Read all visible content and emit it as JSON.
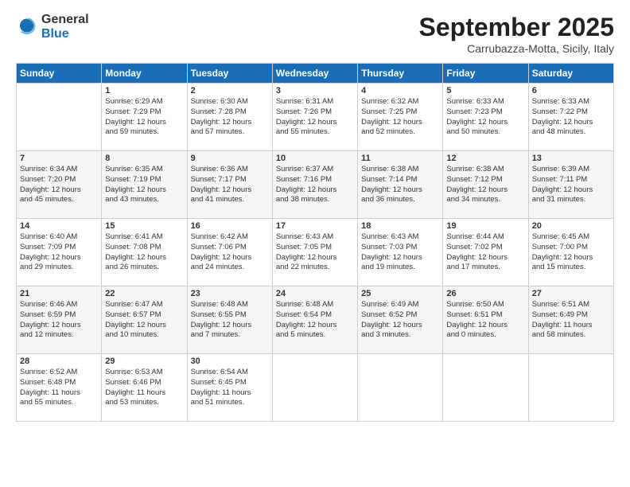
{
  "logo": {
    "line1": "General",
    "line2": "Blue"
  },
  "title": "September 2025",
  "location": "Carrubazza-Motta, Sicily, Italy",
  "headers": [
    "Sunday",
    "Monday",
    "Tuesday",
    "Wednesday",
    "Thursday",
    "Friday",
    "Saturday"
  ],
  "weeks": [
    [
      {
        "day": "",
        "info": ""
      },
      {
        "day": "1",
        "info": "Sunrise: 6:29 AM\nSunset: 7:29 PM\nDaylight: 12 hours\nand 59 minutes."
      },
      {
        "day": "2",
        "info": "Sunrise: 6:30 AM\nSunset: 7:28 PM\nDaylight: 12 hours\nand 57 minutes."
      },
      {
        "day": "3",
        "info": "Sunrise: 6:31 AM\nSunset: 7:26 PM\nDaylight: 12 hours\nand 55 minutes."
      },
      {
        "day": "4",
        "info": "Sunrise: 6:32 AM\nSunset: 7:25 PM\nDaylight: 12 hours\nand 52 minutes."
      },
      {
        "day": "5",
        "info": "Sunrise: 6:33 AM\nSunset: 7:23 PM\nDaylight: 12 hours\nand 50 minutes."
      },
      {
        "day": "6",
        "info": "Sunrise: 6:33 AM\nSunset: 7:22 PM\nDaylight: 12 hours\nand 48 minutes."
      }
    ],
    [
      {
        "day": "7",
        "info": "Sunrise: 6:34 AM\nSunset: 7:20 PM\nDaylight: 12 hours\nand 45 minutes."
      },
      {
        "day": "8",
        "info": "Sunrise: 6:35 AM\nSunset: 7:19 PM\nDaylight: 12 hours\nand 43 minutes."
      },
      {
        "day": "9",
        "info": "Sunrise: 6:36 AM\nSunset: 7:17 PM\nDaylight: 12 hours\nand 41 minutes."
      },
      {
        "day": "10",
        "info": "Sunrise: 6:37 AM\nSunset: 7:16 PM\nDaylight: 12 hours\nand 38 minutes."
      },
      {
        "day": "11",
        "info": "Sunrise: 6:38 AM\nSunset: 7:14 PM\nDaylight: 12 hours\nand 36 minutes."
      },
      {
        "day": "12",
        "info": "Sunrise: 6:38 AM\nSunset: 7:12 PM\nDaylight: 12 hours\nand 34 minutes."
      },
      {
        "day": "13",
        "info": "Sunrise: 6:39 AM\nSunset: 7:11 PM\nDaylight: 12 hours\nand 31 minutes."
      }
    ],
    [
      {
        "day": "14",
        "info": "Sunrise: 6:40 AM\nSunset: 7:09 PM\nDaylight: 12 hours\nand 29 minutes."
      },
      {
        "day": "15",
        "info": "Sunrise: 6:41 AM\nSunset: 7:08 PM\nDaylight: 12 hours\nand 26 minutes."
      },
      {
        "day": "16",
        "info": "Sunrise: 6:42 AM\nSunset: 7:06 PM\nDaylight: 12 hours\nand 24 minutes."
      },
      {
        "day": "17",
        "info": "Sunrise: 6:43 AM\nSunset: 7:05 PM\nDaylight: 12 hours\nand 22 minutes."
      },
      {
        "day": "18",
        "info": "Sunrise: 6:43 AM\nSunset: 7:03 PM\nDaylight: 12 hours\nand 19 minutes."
      },
      {
        "day": "19",
        "info": "Sunrise: 6:44 AM\nSunset: 7:02 PM\nDaylight: 12 hours\nand 17 minutes."
      },
      {
        "day": "20",
        "info": "Sunrise: 6:45 AM\nSunset: 7:00 PM\nDaylight: 12 hours\nand 15 minutes."
      }
    ],
    [
      {
        "day": "21",
        "info": "Sunrise: 6:46 AM\nSunset: 6:59 PM\nDaylight: 12 hours\nand 12 minutes."
      },
      {
        "day": "22",
        "info": "Sunrise: 6:47 AM\nSunset: 6:57 PM\nDaylight: 12 hours\nand 10 minutes."
      },
      {
        "day": "23",
        "info": "Sunrise: 6:48 AM\nSunset: 6:55 PM\nDaylight: 12 hours\nand 7 minutes."
      },
      {
        "day": "24",
        "info": "Sunrise: 6:48 AM\nSunset: 6:54 PM\nDaylight: 12 hours\nand 5 minutes."
      },
      {
        "day": "25",
        "info": "Sunrise: 6:49 AM\nSunset: 6:52 PM\nDaylight: 12 hours\nand 3 minutes."
      },
      {
        "day": "26",
        "info": "Sunrise: 6:50 AM\nSunset: 6:51 PM\nDaylight: 12 hours\nand 0 minutes."
      },
      {
        "day": "27",
        "info": "Sunrise: 6:51 AM\nSunset: 6:49 PM\nDaylight: 11 hours\nand 58 minutes."
      }
    ],
    [
      {
        "day": "28",
        "info": "Sunrise: 6:52 AM\nSunset: 6:48 PM\nDaylight: 11 hours\nand 55 minutes."
      },
      {
        "day": "29",
        "info": "Sunrise: 6:53 AM\nSunset: 6:46 PM\nDaylight: 11 hours\nand 53 minutes."
      },
      {
        "day": "30",
        "info": "Sunrise: 6:54 AM\nSunset: 6:45 PM\nDaylight: 11 hours\nand 51 minutes."
      },
      {
        "day": "",
        "info": ""
      },
      {
        "day": "",
        "info": ""
      },
      {
        "day": "",
        "info": ""
      },
      {
        "day": "",
        "info": ""
      }
    ]
  ]
}
